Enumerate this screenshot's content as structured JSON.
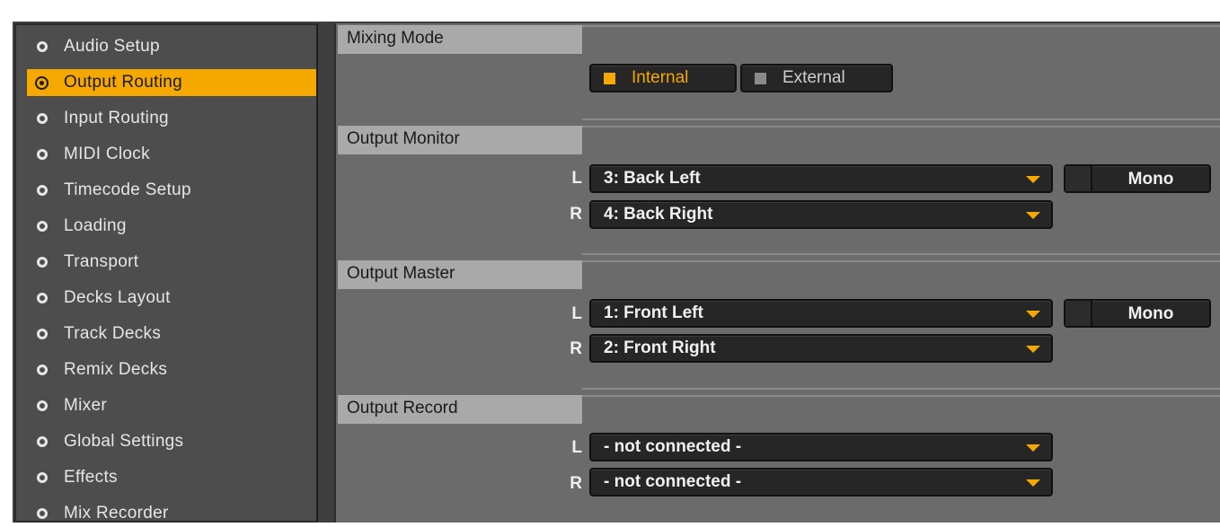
{
  "sidebar": {
    "items": [
      {
        "label": "Audio Setup",
        "active": false
      },
      {
        "label": "Output Routing",
        "active": true
      },
      {
        "label": "Input Routing",
        "active": false
      },
      {
        "label": "MIDI Clock",
        "active": false
      },
      {
        "label": "Timecode Setup",
        "active": false
      },
      {
        "label": "Loading",
        "active": false
      },
      {
        "label": "Transport",
        "active": false
      },
      {
        "label": "Decks Layout",
        "active": false
      },
      {
        "label": "Track Decks",
        "active": false
      },
      {
        "label": "Remix Decks",
        "active": false
      },
      {
        "label": "Mixer",
        "active": false
      },
      {
        "label": "Global Settings",
        "active": false
      },
      {
        "label": "Effects",
        "active": false
      },
      {
        "label": "Mix Recorder",
        "active": false
      }
    ]
  },
  "mixing_mode": {
    "title": "Mixing Mode",
    "internal_label": "Internal",
    "external_label": "External",
    "selected": "Internal"
  },
  "output_monitor": {
    "title": "Output Monitor",
    "left_label": "L",
    "right_label": "R",
    "left_value": "3: Back Left",
    "right_value": "4: Back Right",
    "mono_label": "Mono"
  },
  "output_master": {
    "title": "Output Master",
    "left_label": "L",
    "right_label": "R",
    "left_value": "1: Front Left",
    "right_value": "2: Front Right",
    "mono_label": "Mono"
  },
  "output_record": {
    "title": "Output Record",
    "left_label": "L",
    "right_label": "R",
    "left_value": "- not connected -",
    "right_value": "- not connected -"
  },
  "colors": {
    "accent": "#f5a800",
    "panel": "#6b6b6b",
    "sidebar": "#4d4d4d",
    "header": "#a9a9a9",
    "control": "#262626"
  }
}
